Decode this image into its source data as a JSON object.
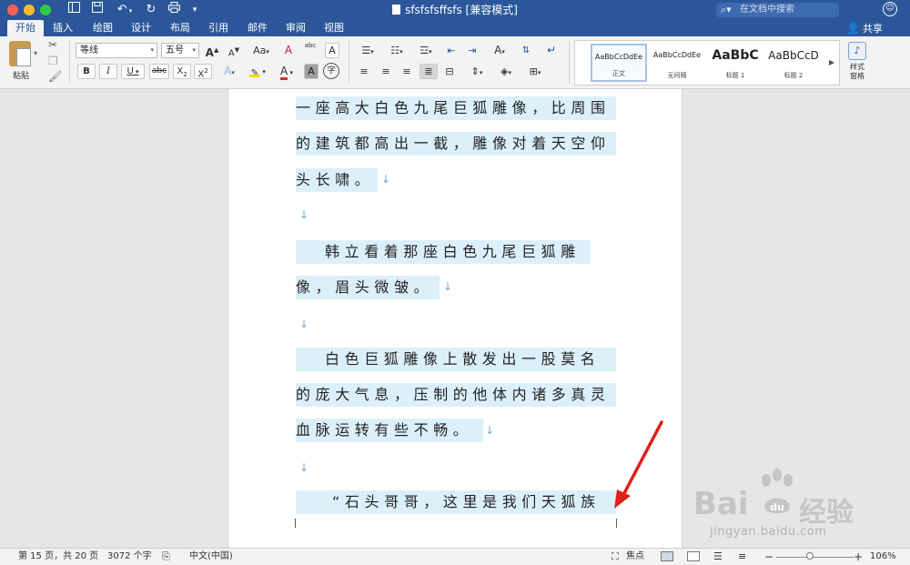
{
  "window": {
    "title": "sfsfsfsffsfs [兼容模式]",
    "search_placeholder": "在文档中搜索",
    "share_label": "共享"
  },
  "quick_access": {
    "sidebar_icon": "sidebar-icon",
    "save_icon": "save-icon",
    "undo_icon": "undo-icon",
    "redo_icon": "redo-icon",
    "print_icon": "print-icon",
    "customize_icon": "customize-icon"
  },
  "tabs": [
    {
      "label": "开始",
      "active": true
    },
    {
      "label": "插入"
    },
    {
      "label": "绘图"
    },
    {
      "label": "设计"
    },
    {
      "label": "布局"
    },
    {
      "label": "引用"
    },
    {
      "label": "邮件"
    },
    {
      "label": "审阅"
    },
    {
      "label": "视图"
    }
  ],
  "ribbon": {
    "paste_label": "粘贴",
    "font_name": "等线",
    "font_size": "五号",
    "styles": [
      {
        "preview": "AaBbCcDdEe",
        "name": "正文",
        "selected": true
      },
      {
        "preview": "AaBbCcDdEe",
        "name": "无间隔"
      },
      {
        "preview": "AaBbC",
        "name": "标题 1"
      },
      {
        "preview": "AaBbCcD",
        "name": "标题 2"
      }
    ],
    "styles_pane_label_1": "样式",
    "styles_pane_label_2": "窗格",
    "font_buttons": {
      "grow": "A",
      "shrink": "A",
      "case": "Aa",
      "clear": "A",
      "phonetic": "abc",
      "border_char": "A",
      "bold": "B",
      "italic": "I",
      "underline": "U",
      "strike": "abc",
      "sub": "X",
      "sup": "X",
      "effect": "A",
      "color": "A",
      "shade": "A",
      "enclose": "字"
    },
    "accent_color": "#2b579a",
    "highlight_color": "#ffd800",
    "font_color": "#d32f2f"
  },
  "document": {
    "lines": [
      {
        "text": "一座高大白色九尾巨狐雕像，比周围"
      },
      {
        "text": "的建筑都高出一截，雕像对着天空仰"
      },
      {
        "text": "头长啸。"
      },
      {
        "text": "韩立看着那座白色九尾巨狐雕"
      },
      {
        "text": "像，眉头微皱。"
      },
      {
        "text": "白色巨狐雕像上散发出一股莫名"
      },
      {
        "text": "的庞大气息，压制的他体内诸多真灵"
      },
      {
        "text": "血脉运转有些不畅。"
      },
      {
        "text": "“石头哥哥，这里是我们天狐族"
      }
    ],
    "paragraph_mark": "↓",
    "highlight_color": "#dcf0fb"
  },
  "status": {
    "page_info": "第 15 页，共 20 页",
    "word_count": "3072 个字",
    "language": "中文(中国)",
    "focus_label": "焦点",
    "zoom": "106%",
    "zoom_out": "−",
    "zoom_in": "+"
  },
  "watermark": {
    "brand_left": "Bai",
    "brand_right": "经验",
    "url": "jingyan.baidu.com"
  }
}
